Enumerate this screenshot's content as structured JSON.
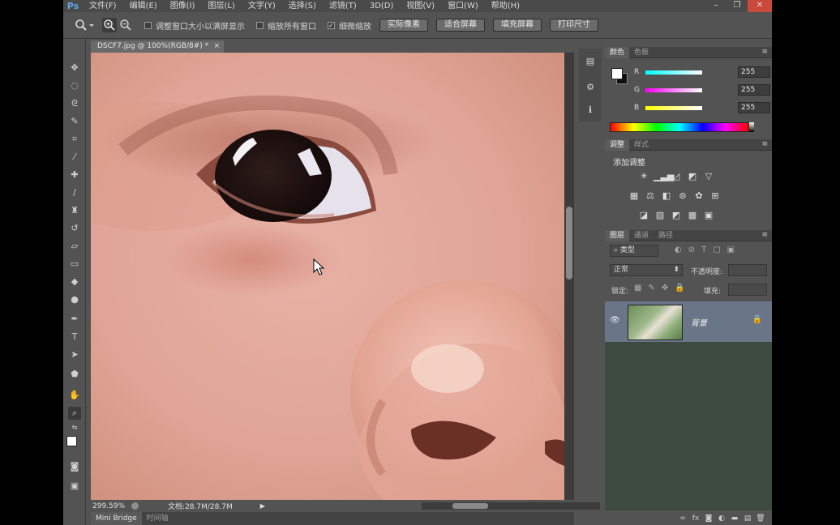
{
  "app": {
    "logo": "Ps"
  },
  "menu": [
    "文件(F)",
    "编辑(E)",
    "图像(I)",
    "图层(L)",
    "文字(Y)",
    "选择(S)",
    "滤镜(T)",
    "3D(D)",
    "视图(V)",
    "窗口(W)",
    "帮助(H)"
  ],
  "window_controls": {
    "minimize": "–",
    "restore": "❐",
    "close": "✕"
  },
  "options": {
    "resize_windows": {
      "label": "调整窗口大小以满屏显示",
      "checked": false
    },
    "zoom_all": {
      "label": "缩放所有窗口",
      "checked": false
    },
    "scrubby_zoom": {
      "label": "细微缩放",
      "checked": true
    },
    "buttons": [
      "实际像素",
      "适合屏幕",
      "填充屏幕",
      "打印尺寸"
    ]
  },
  "document": {
    "tab_title": "DSCF7.jpg @ 100%(RGB/8#) *",
    "close": "×",
    "zoom_readout": "299.59%",
    "doc_size": "文档:28.7M/28.7M"
  },
  "bottom_tabs": [
    "Mini Bridge",
    "时间轴"
  ],
  "color_panel": {
    "tabs": [
      "颜色",
      "色板"
    ],
    "channels": [
      {
        "label": "R",
        "value": "255"
      },
      {
        "label": "G",
        "value": "255"
      },
      {
        "label": "B",
        "value": "255"
      }
    ],
    "colors": {
      "foreground": "#ffffff",
      "background": "#111111"
    }
  },
  "adjustments_panel": {
    "tabs": [
      "调整",
      "样式"
    ],
    "title": "添加调整"
  },
  "layers_panel": {
    "tabs": [
      "图层",
      "通道",
      "路径"
    ],
    "filter_kind": "类型",
    "blend_mode": "正常",
    "opacity_label": "不透明度:",
    "lock_label": "锁定:",
    "fill_label": "填充:",
    "layer": {
      "name": "背景"
    }
  },
  "accent": "#6a7688"
}
